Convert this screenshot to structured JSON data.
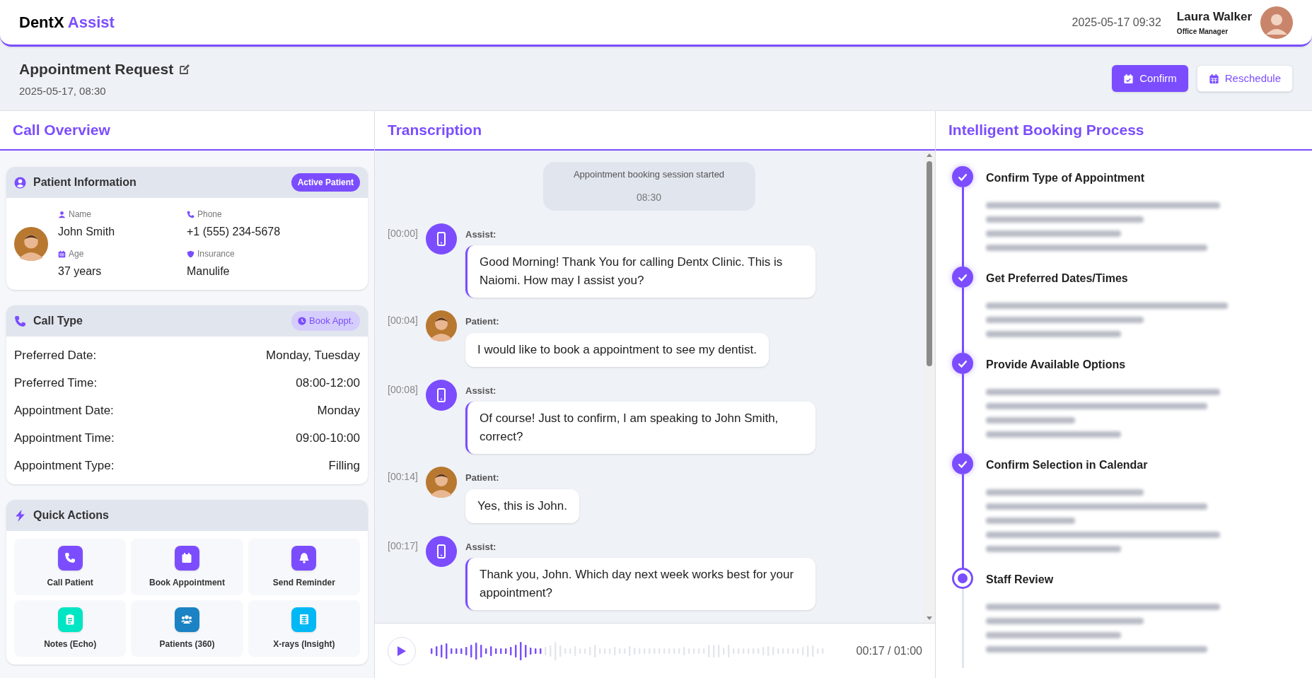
{
  "header": {
    "brand": "DentX",
    "brand_accent": "Assist",
    "datetime": "2025-05-17 09:32",
    "user": {
      "name": "Laura Walker",
      "role": "Office Manager"
    }
  },
  "request": {
    "title": "Appointment Request",
    "datetime": "2025-05-17, 08:30",
    "actions": [
      {
        "label": "Confirm",
        "kind": "primary"
      },
      {
        "label": "Reschedule",
        "kind": "secondary"
      }
    ]
  },
  "call_overview": {
    "title": "Call Overview",
    "patient_card": {
      "title": "Patient Information",
      "badge": "Active Patient",
      "fields": [
        {
          "kind": "name",
          "label": "Name",
          "value": "John Smith"
        },
        {
          "kind": "phone",
          "label": "Phone",
          "value": "+1 (555) 234-5678"
        },
        {
          "kind": "age",
          "label": "Age",
          "value": "37 years"
        },
        {
          "kind": "insurance",
          "label": "Insurance",
          "value": "Manulife"
        }
      ]
    },
    "call_type": {
      "title": "Call Type",
      "badge": "Book Appt.",
      "rows": [
        {
          "label": "Preferred Date:",
          "value": "Monday, Tuesday"
        },
        {
          "label": "Preferred Time:",
          "value": "08:00-12:00"
        },
        {
          "label": "Appointment Date:",
          "value": "Monday"
        },
        {
          "label": "Appointment Time:",
          "value": "09:00-10:00"
        },
        {
          "label": "Appointment Type:",
          "value": "Filling"
        }
      ]
    },
    "quick_actions": {
      "title": "Quick Actions",
      "items": [
        {
          "label": "Call Patient",
          "kind": "phone",
          "color": "#7b4dff"
        },
        {
          "label": "Book Appointment",
          "kind": "calendar",
          "color": "#7b4dff"
        },
        {
          "label": "Send Reminder",
          "kind": "bell",
          "color": "#7b4dff"
        },
        {
          "label": "Notes (Echo)",
          "kind": "clipboard",
          "color": "#00e5c3"
        },
        {
          "label": "Patients (360)",
          "kind": "users",
          "color": "#1b82c4"
        },
        {
          "label": "X-rays (Insight)",
          "kind": "xray",
          "color": "#00b8f5"
        }
      ]
    }
  },
  "transcription": {
    "title": "Transcription",
    "session": {
      "text": "Appointment booking session started",
      "time": "08:30"
    },
    "messages": [
      {
        "time": "[00:00]",
        "speaker": "Assist:",
        "kind": "assistant",
        "text": "Good Morning! Thank You for calling Dentx Clinic. This is Naiomi. How may I assist you?"
      },
      {
        "time": "[00:04]",
        "speaker": "Patient:",
        "kind": "patient",
        "text": "I would like to book a appointment to see my dentist."
      },
      {
        "time": "[00:08]",
        "speaker": "Assist:",
        "kind": "assistant",
        "text": "Of course! Just to confirm, I am speaking to John Smith, correct?"
      },
      {
        "time": "[00:14]",
        "speaker": "Patient:",
        "kind": "patient",
        "text": "Yes, this is John."
      },
      {
        "time": "[00:17]",
        "speaker": "Assist:",
        "kind": "assistant",
        "text": "Thank you, John. Which day next week works best for your appointment?"
      }
    ],
    "player": {
      "level": 0.283,
      "time": "00:17 / 01:00"
    }
  },
  "booking_process": {
    "title": "Intelligent Booking Process",
    "steps": [
      {
        "title": "Confirm Type of Appointment",
        "completed": true
      },
      {
        "title": "Get Preferred Dates/Times",
        "completed": true
      },
      {
        "title": "Provide Available Options",
        "completed": true
      },
      {
        "title": "Confirm Selection in Calendar",
        "completed": true
      },
      {
        "title": "Staff Review",
        "completed": false
      }
    ]
  }
}
